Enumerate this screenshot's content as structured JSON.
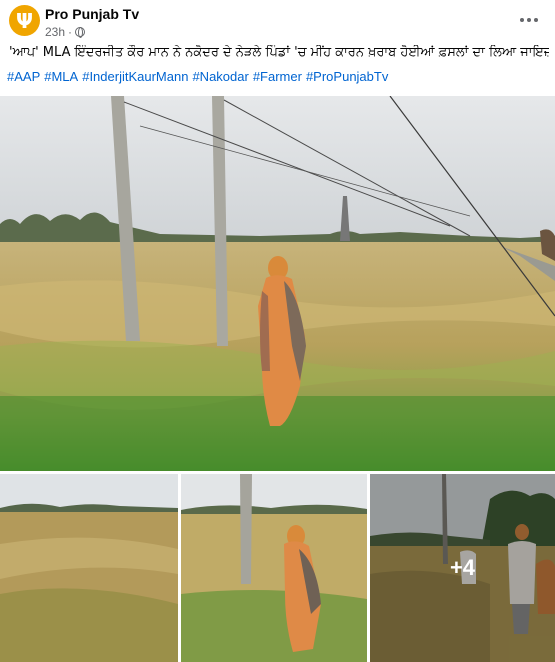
{
  "post": {
    "author": "Pro Punjab Tv",
    "avatar_glyph": "Ψ",
    "time": "23h",
    "dot": "·",
    "caption": "'ਆਪ' MLA ਇੰਦਰਜੀਤ ਕੌਰ ਮਾਨ ਨੇ ਨਕੋਦਰ ਦੇ ਨੇੜਲੇ ਪਿੰਡਾਂ 'ਚ ਮੀਂਹ ਕਾਰਨ ਖ਼ਰਾਬ ਹੋਈਆਂ ਫ਼ਸਲਾਂ ਦਾ ਲਿਆ ਜਾਇਜ਼ਾ",
    "hashtags": [
      "#AAP",
      "#MLA",
      "#InderjitKaurMann",
      "#Nakodar",
      "#Farmer",
      "#ProPunjabTv"
    ],
    "more_photos": "+4"
  },
  "colors": {
    "avatar": "#f0a500",
    "link": "#0064d1",
    "muted": "#65676b"
  },
  "icons": {
    "privacy": "globe-icon",
    "menu": "more-horizontal-icon"
  }
}
